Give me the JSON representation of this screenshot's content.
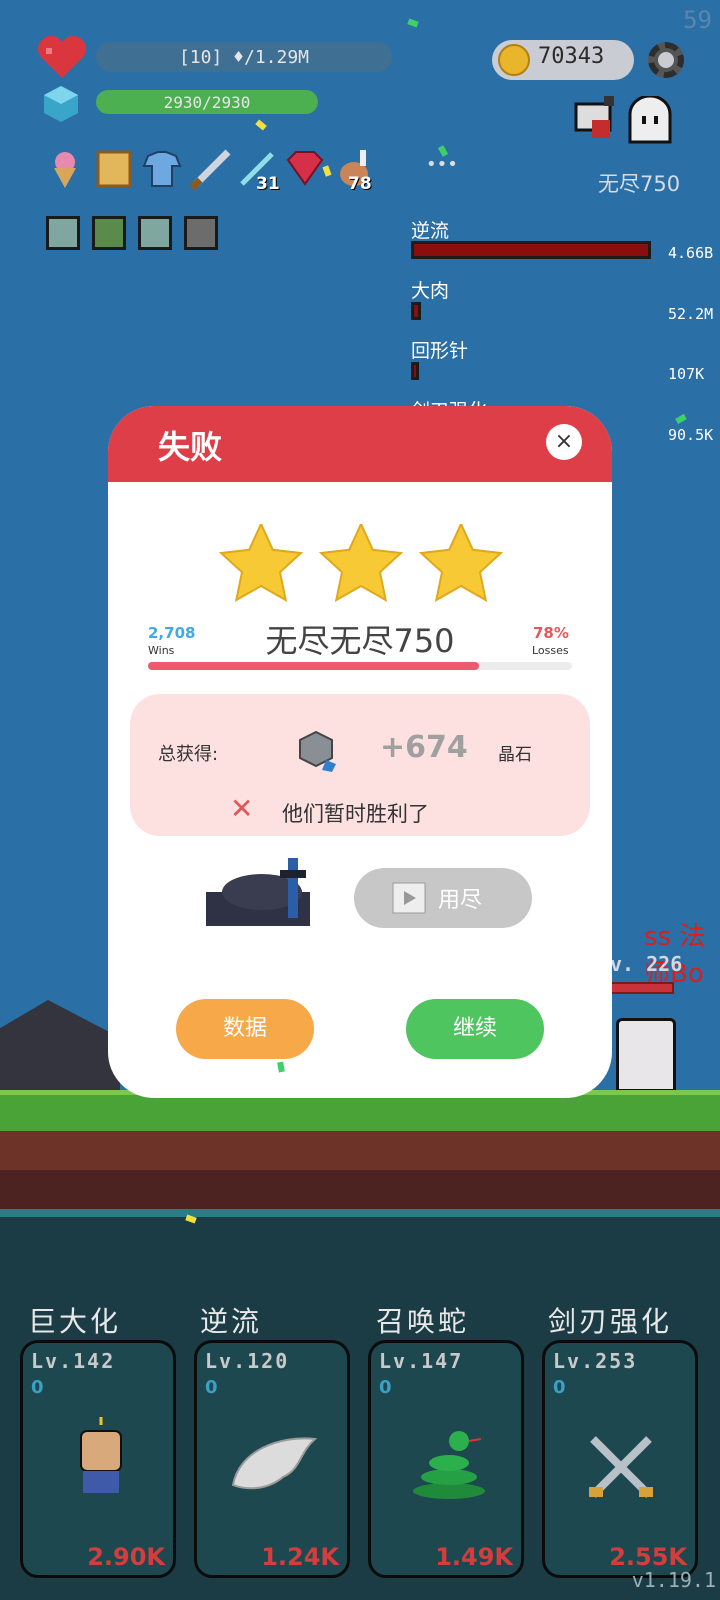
{
  "hud": {
    "fps": "59",
    "hp_text": "[10] ♦/1.29M",
    "mp_text": "2930/2930",
    "mp_fraction": 1.0,
    "coins": "70343",
    "item_counts": [
      "31",
      "78"
    ],
    "more": "•••",
    "wave_label": "无尽750"
  },
  "damage_list": [
    {
      "name": "逆流",
      "value": "4.66B",
      "fraction": 1.0
    },
    {
      "name": "大肉",
      "value": "52.2M",
      "fraction": 0.011
    },
    {
      "name": "回形针",
      "value": "107K",
      "fraction": 0.005
    },
    {
      "name": "剑刃强化",
      "value": "90.5K",
      "fraction": 0.005
    }
  ],
  "modal": {
    "title": "失败",
    "close_icon": "×",
    "stars": 3,
    "wins_count": "2,708",
    "wins_label": "Wins",
    "losses_pct": "78%",
    "losses_label": "Losses",
    "mode_name": "无尽无尽750",
    "progress_fraction": 0.78,
    "reward_label": "总获得:",
    "reward_value": "+674",
    "reward_unit": "晶石",
    "result_message": "他们暂时胜利了",
    "used_label": "用尽",
    "data_button": "数据",
    "continue_button": "继续"
  },
  "enemy": {
    "name": "ss 法师Bo",
    "level": "v. 226"
  },
  "skills": [
    {
      "title": "巨大化",
      "level": "Lv.142",
      "points": "0",
      "cost": "2.90K",
      "icon": "fist-icon"
    },
    {
      "title": "逆流",
      "level": "Lv.120",
      "points": "0",
      "cost": "1.24K",
      "icon": "wing-icon"
    },
    {
      "title": "召唤蛇",
      "level": "Lv.147",
      "points": "0",
      "cost": "1.49K",
      "icon": "snake-icon"
    },
    {
      "title": "剑刃强化",
      "level": "Lv.253",
      "points": "0",
      "cost": "2.55K",
      "icon": "crossed-swords-icon"
    }
  ],
  "version": "v1.19.1",
  "colors": {
    "sky": "#2a6fa6",
    "modal_header": "#dd3e47",
    "data_button": "#f7a94a",
    "continue_button": "#4ec55e",
    "skill_cost": "#d23e3e"
  }
}
